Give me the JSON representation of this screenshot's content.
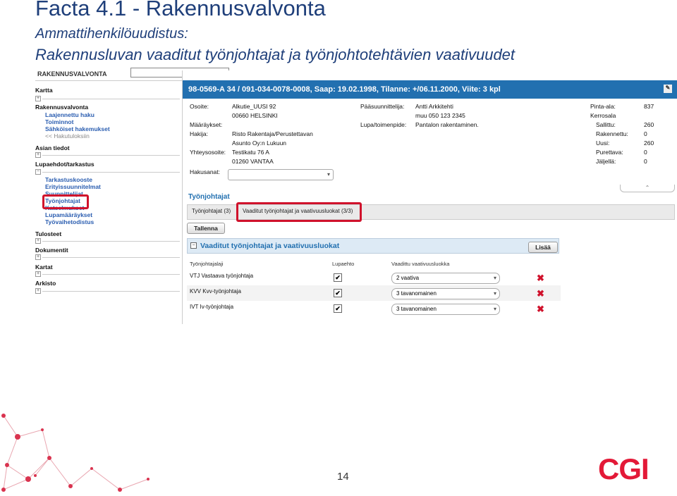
{
  "slide": {
    "title": "Facta 4.1 - Rakennusvalvonta",
    "subtitle1": "Ammattihenkilöuudistus:",
    "subtitle2": "Rakennusluvan vaaditut työnjohtajat ja työnjohtotehtävien vaativuudet",
    "page_number": "14",
    "logo_text": "CGI"
  },
  "sidebar": {
    "header": "RAKENNUSVALVONTA",
    "sections": [
      {
        "label": "Kartta"
      },
      {
        "label": "Rakennusvalvonta"
      },
      {
        "label": "Asian tiedot"
      },
      {
        "label": "Lupaehdot/tarkastus"
      },
      {
        "label": "Tulosteet"
      },
      {
        "label": "Dokumentit"
      },
      {
        "label": "Kartat"
      },
      {
        "label": "Arkisto"
      }
    ],
    "rv_links": [
      "Laajennettu haku",
      "Toiminnot",
      "Sähköiset hakemukset"
    ],
    "back_link": "<< Hakutuloksiin",
    "lupa_links": [
      "Tarkastuskooste",
      "Erityissuunnitelmat",
      "Suunnittelijat",
      "Työnjohtajat",
      "Katselmukset",
      "Lupamääräykset",
      "Työvaihetodistus"
    ]
  },
  "header": {
    "title": "98-0569-A 34 / 091-034-0078-0008, Saap: 19.02.1998, Tilanne: +/06.11.2000, Viite: 3 kpl"
  },
  "info": {
    "osoite_label": "Osoite:",
    "osoite_value": "Alkutie_UUSI 92",
    "postal": "00660 HELSINKI",
    "maaraykset_label": "Määräykset:",
    "hakija_label": "Hakija:",
    "hakija_value1": "Risto Rakentaja/Perustettavan",
    "hakija_value2": "Asunto Oy:n Lukuun",
    "yhteys_label": "Yhteysosoite:",
    "yhteys_value1": "Testikatu 76 A",
    "yhteys_value2": "01260 VANTAA",
    "hakusanat_label": "Hakusanat:",
    "paasuunnittelija_label": "Pääsuunnittelija:",
    "paasuunnittelija_value1": "Antti Arkkitehti",
    "paasuunnittelija_value2": "muu 050 123 2345",
    "lupa_label": "Lupa/toimenpide:",
    "lupa_value": "Pantalon rakentaminen.",
    "pinta_label": "Pinta-ala:",
    "pinta_value": "837",
    "kerrosala_label": "Kerrosala",
    "sallittu_label": "Sallittu:",
    "sallittu_value": "260",
    "rakennettu_label": "Rakennettu:",
    "rakennettu_value": "0",
    "uusi_label": "Uusi:",
    "uusi_value": "260",
    "purettava_label": "Purettava:",
    "purettava_value": "0",
    "jaljella_label": "Jäljellä:",
    "jaljella_value": "0"
  },
  "tyonjohtajat": {
    "title": "Työnjohtajat",
    "tabs": [
      "Työnjohtajat (3)",
      "Vaaditut työnjohtajat ja vaativuusluokat (3/3)"
    ],
    "save_button": "Tallenna",
    "section_title": "Vaaditut työnjohtajat ja vaativuusluokat",
    "add_button": "Lisää",
    "columns": [
      "Työnjohtajalaji",
      "Lupaehto",
      "Vaadittu vaativuusluokka"
    ],
    "rows": [
      {
        "laji": "VTJ Vastaava työnjohtaja",
        "lupaehto": "✔",
        "luokka": "2   vaativa"
      },
      {
        "laji": "KVV Kvv-työnjohtaja",
        "lupaehto": "✔",
        "luokka": "3   tavanomainen"
      },
      {
        "laji": "IVT Iv-työnjohtaja",
        "lupaehto": "✔",
        "luokka": "3   tavanomainen"
      }
    ]
  },
  "colors": {
    "header_blue": "#2270b0",
    "title_blue": "#1f3f7a",
    "highlight_red": "#d0122c",
    "brand_red": "#e31937"
  }
}
